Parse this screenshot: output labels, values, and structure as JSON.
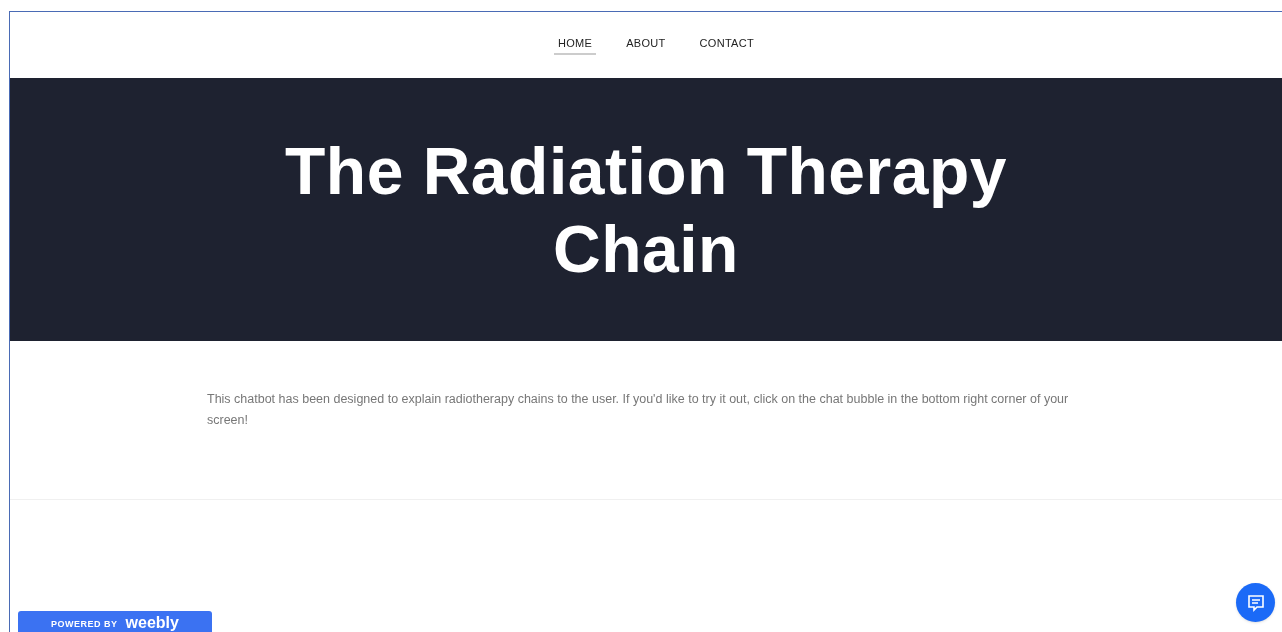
{
  "nav": [
    {
      "label": "HOME",
      "selected": true
    },
    {
      "label": "ABOUT",
      "selected": false
    },
    {
      "label": "CONTACT",
      "selected": false
    }
  ],
  "hero": {
    "title": "The Radiation Therapy Chain"
  },
  "intro": "This chatbot has been designed to explain radiotherapy chains to the user. If you'd like to try it out, click on the chat bubble in the bottom right corner of your screen!",
  "badge": {
    "prefix": "POWERED BY",
    "brand": "weebly"
  }
}
